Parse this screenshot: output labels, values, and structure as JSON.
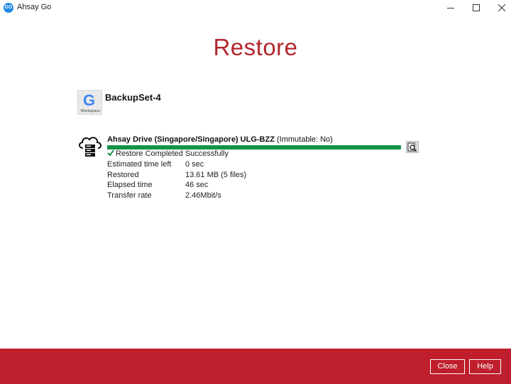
{
  "window": {
    "app_logo": "GO",
    "title": "Ahsay Go"
  },
  "page": {
    "title": "Restore"
  },
  "backup_set": {
    "icon": "google-workspace-icon",
    "icon_letter": "G",
    "icon_caption": "Workspace",
    "name": "BackupSet-4"
  },
  "destination": {
    "icon": "cloud-server-icon",
    "name": "Ahsay Drive (Singapore/Singapore) ULG-BZZ",
    "immutable": "(Immutable: No)",
    "progress_percent": 100,
    "status": "Restore Completed Successfully",
    "stats": [
      {
        "label": "Estimated time left",
        "value": "0 sec"
      },
      {
        "label": "Restored",
        "value": "13.61 MB (5 files)"
      },
      {
        "label": "Elapsed time",
        "value": "46 sec"
      },
      {
        "label": "Transfer rate",
        "value": "2.46Mbit/s"
      }
    ]
  },
  "footer": {
    "close_label": "Close",
    "help_label": "Help"
  },
  "colors": {
    "accent": "#bf1e2d",
    "title": "#b3262e",
    "progress": "#159447"
  }
}
